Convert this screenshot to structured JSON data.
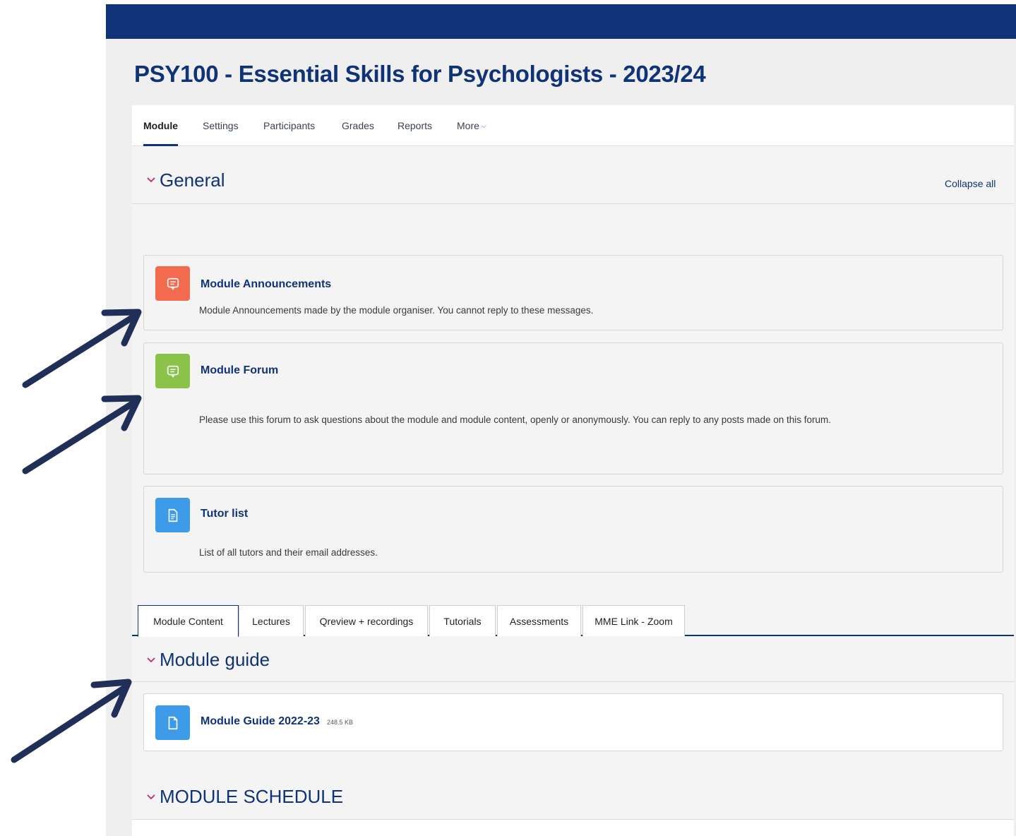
{
  "course": {
    "title": "PSY100 - Essential Skills for Psychologists - 2023/24"
  },
  "nav": {
    "items": [
      "Module",
      "Settings",
      "Participants",
      "Grades",
      "Reports",
      "More"
    ],
    "more_chevron": "⌄"
  },
  "general": {
    "title": "General",
    "collapse_all": "Collapse all",
    "activities": [
      {
        "name": "Module Announcements",
        "description": "Module Announcements made by the module organiser. You cannot reply to these messages.",
        "icon": "forum-icon",
        "color": "#f26b4f"
      },
      {
        "name": "Module Forum",
        "description": "Please use this forum to ask questions about the module and module content, openly or anonymously. You can reply to any posts made on this forum.",
        "icon": "forum-icon",
        "color": "#8bc34a"
      },
      {
        "name": "Tutor list",
        "description": "List of all tutors and their email addresses.",
        "icon": "page-icon",
        "color": "#3d9be9"
      }
    ]
  },
  "tabs": [
    "Module Content",
    "Lectures",
    "Qreview + recordings",
    "Tutorials",
    "Assessments",
    "MME Link - Zoom"
  ],
  "module_guide": {
    "title": "Module guide",
    "file": {
      "name": "Module Guide 2022-23",
      "size": "248.5 KB",
      "icon": "file-icon",
      "color": "#3d9be9"
    }
  },
  "module_schedule": {
    "title": "MODULE SCHEDULE"
  },
  "colors": {
    "brand": "#0f3376",
    "accent": "#c0296f"
  }
}
